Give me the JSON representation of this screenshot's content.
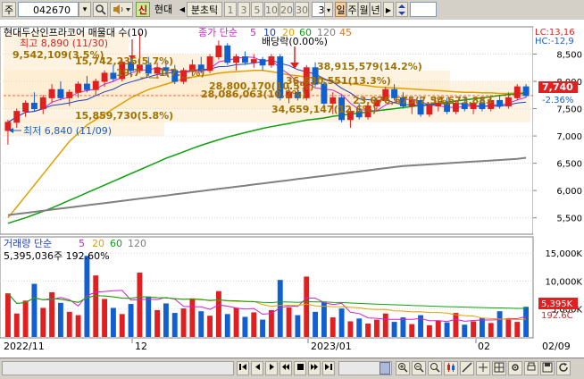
{
  "toolbar": {
    "menu_label": "주",
    "stock_code": "042670",
    "dropdown_glyph": "▾",
    "search_icon": "magnifier",
    "speaker_icon": "speaker",
    "credit_badge": "신",
    "stock_name": "현대",
    "prev_arrow": "◀",
    "period_label": "분초틱",
    "intervals": [
      "1",
      "3",
      "5",
      "10",
      "20",
      "30"
    ],
    "selected_count": "3",
    "period_tabs": [
      "일",
      "주",
      "월",
      "년"
    ],
    "selected_period": "일",
    "nav_arrow": "▶",
    "updown_icon": "updown-arrows"
  },
  "price_panel": {
    "legend_title": "현대두산인프라코어 매물대 수(10)",
    "legend_ma_label": "종가 단순",
    "legend_ma_periods": [
      "5",
      "10",
      "20",
      "60",
      "120",
      "45"
    ],
    "annotations": {
      "high": "최고 8,890 (11/30)",
      "low": "최저 6,840 (11/09)",
      "dividend": "배당락(0.00%)"
    },
    "volume_profile_labels": [
      "9,542,109(3.5%)",
      "15,742,236(5.7%)",
      "19,7_,__1(7.__%)",
      "28,086,063(10.2%)",
      "28,800,170(10.5%)",
      "38,915,579(14.2%)",
      "36,630,551(13.3%)",
      "34,659,147(12.6%)",
      "23,076,675(7.5%)",
      "34,673,883",
      "15,859,730(5.8%)"
    ],
    "right_labels": {
      "lc": "LC:13,16",
      "hc": "HC:-12,9",
      "current_price": "7,740",
      "change_pct": "-2.36%"
    }
  },
  "volume_panel": {
    "legend_title": "거래량 단순",
    "legend_ma_periods": [
      "5",
      "20",
      "60",
      "120"
    ],
    "summary": "5,395,036주 192.60%",
    "right_labels": {
      "current_volume": "5,395K",
      "volume_ratio": "192.6C"
    }
  },
  "x_axis": {
    "labels": [
      "2022/11",
      "12",
      "2023/01",
      "02",
      "02/09"
    ]
  },
  "colors": {
    "up": "#e02020",
    "down": "#1060d0",
    "ma5": "#d020d0",
    "ma10": "#2040c0",
    "ma20": "#e0a000",
    "ma60": "#10a010",
    "ma120": "#808080",
    "ma45": "#e07820",
    "profile": "#fde9c9"
  },
  "chart_data": [
    {
      "type": "candlestick",
      "title": "현대두산인프라코어 매물대 수(10)",
      "y_ticks": [
        5500,
        6000,
        6500,
        7000,
        7500,
        8000,
        8500
      ],
      "ylim": [
        5200,
        9000
      ],
      "x_start_date": "2022/11",
      "x_end_date": "2023/02/09",
      "ohlc": [
        [
          7100,
          7300,
          6840,
          7250
        ],
        [
          7250,
          7500,
          7150,
          7450
        ],
        [
          7450,
          7650,
          7350,
          7600
        ],
        [
          7600,
          7800,
          7450,
          7500
        ],
        [
          7500,
          7750,
          7400,
          7700
        ],
        [
          7700,
          7950,
          7600,
          7850
        ],
        [
          7850,
          8000,
          7650,
          7700
        ],
        [
          7700,
          7850,
          7550,
          7800
        ],
        [
          7800,
          8000,
          7700,
          7950
        ],
        [
          7950,
          8100,
          7800,
          7850
        ],
        [
          7850,
          8050,
          7750,
          8000
        ],
        [
          8000,
          8200,
          7900,
          8150
        ],
        [
          8150,
          8300,
          8000,
          8050
        ],
        [
          8050,
          8400,
          8000,
          8350
        ],
        [
          8350,
          8450,
          8100,
          8200
        ],
        [
          8200,
          8890,
          8150,
          8300
        ],
        [
          8300,
          8450,
          8100,
          8150
        ],
        [
          8150,
          8350,
          8050,
          8250
        ],
        [
          8250,
          8400,
          8100,
          8200
        ],
        [
          8200,
          8300,
          7950,
          8000
        ],
        [
          8000,
          8250,
          7950,
          8200
        ],
        [
          8200,
          8400,
          8100,
          8300
        ],
        [
          8300,
          8450,
          8150,
          8200
        ],
        [
          8200,
          8500,
          8150,
          8450
        ],
        [
          8450,
          8750,
          8400,
          8650
        ],
        [
          8650,
          8700,
          8300,
          8350
        ],
        [
          8350,
          8500,
          8200,
          8450
        ],
        [
          8450,
          8550,
          8300,
          8350
        ],
        [
          8350,
          8500,
          8250,
          8400
        ],
        [
          8400,
          8450,
          8200,
          8300
        ],
        [
          8300,
          8500,
          8250,
          8450
        ],
        [
          8450,
          8500,
          7650,
          7700
        ],
        [
          7700,
          7900,
          7600,
          7800
        ],
        [
          7800,
          7950,
          7650,
          7700
        ],
        [
          7700,
          8300,
          7650,
          8250
        ],
        [
          8250,
          8350,
          7900,
          7950
        ],
        [
          7950,
          8000,
          7500,
          7600
        ],
        [
          7600,
          7800,
          7400,
          7700
        ],
        [
          7700,
          7750,
          7250,
          7300
        ],
        [
          7300,
          7500,
          7150,
          7450
        ],
        [
          7450,
          7600,
          7300,
          7350
        ],
        [
          7350,
          7600,
          7300,
          7550
        ],
        [
          7550,
          7700,
          7450,
          7650
        ],
        [
          7650,
          7900,
          7600,
          7850
        ],
        [
          7850,
          7950,
          7650,
          7700
        ],
        [
          7700,
          7800,
          7500,
          7550
        ],
        [
          7550,
          7700,
          7400,
          7650
        ],
        [
          7650,
          7700,
          7350,
          7400
        ],
        [
          7400,
          7600,
          7350,
          7550
        ],
        [
          7550,
          7700,
          7450,
          7600
        ],
        [
          7600,
          7700,
          7400,
          7450
        ],
        [
          7450,
          7650,
          7400,
          7600
        ],
        [
          7600,
          7700,
          7450,
          7500
        ],
        [
          7500,
          7650,
          7400,
          7600
        ],
        [
          7600,
          7700,
          7450,
          7500
        ],
        [
          7500,
          7700,
          7450,
          7650
        ],
        [
          7650,
          7750,
          7500,
          7550
        ],
        [
          7550,
          7800,
          7500,
          7700
        ],
        [
          7700,
          7950,
          7650,
          7900
        ],
        [
          7900,
          7950,
          7700,
          7740
        ]
      ],
      "moving_averages": {
        "ma20": [
          5500,
          5700,
          5900,
          6100,
          6300,
          6500,
          6700,
          6900,
          7050,
          7200,
          7300,
          7400,
          7500,
          7600,
          7700,
          7780,
          7850,
          7900,
          7950,
          8000,
          8050,
          8080,
          8100,
          8120,
          8150,
          8170,
          8180,
          8190,
          8200,
          8200,
          8180,
          8150,
          8120,
          8100,
          8080,
          8060,
          8030,
          8000,
          7980,
          7960,
          7940,
          7920,
          7900,
          7890,
          7880,
          7870,
          7860,
          7850,
          7840,
          7830,
          7820,
          7810,
          7800,
          7800,
          7790,
          7790,
          7780,
          7780,
          7790,
          7800
        ],
        "ma60": [
          5400,
          5450,
          5500,
          5560,
          5620,
          5680,
          5750,
          5820,
          5890,
          5960,
          6030,
          6100,
          6170,
          6240,
          6310,
          6380,
          6450,
          6520,
          6590,
          6650,
          6710,
          6770,
          6830,
          6880,
          6930,
          6980,
          7020,
          7060,
          7100,
          7140,
          7170,
          7200,
          7230,
          7260,
          7290,
          7310,
          7330,
          7360,
          7380,
          7400,
          7420,
          7440,
          7460,
          7480,
          7500,
          7520,
          7540,
          7560,
          7580,
          7600,
          7620,
          7640,
          7660,
          7680,
          7700,
          7720,
          7740,
          7760,
          7770,
          7780
        ],
        "ma120": [
          5550,
          5570,
          5590,
          5610,
          5630,
          5650,
          5670,
          5690,
          5710,
          5730,
          5750,
          5770,
          5790,
          5810,
          5830,
          5850,
          5870,
          5890,
          5910,
          5930,
          5950,
          5970,
          5990,
          6010,
          6030,
          6050,
          6070,
          6090,
          6110,
          6130,
          6150,
          6170,
          6190,
          6210,
          6230,
          6250,
          6270,
          6290,
          6310,
          6330,
          6350,
          6370,
          6390,
          6410,
          6430,
          6450,
          6460,
          6470,
          6480,
          6490,
          6500,
          6510,
          6520,
          6530,
          6540,
          6550,
          6560,
          6570,
          6580,
          6600
        ]
      }
    },
    {
      "type": "bar",
      "title": "거래량",
      "y_ticks": [
        5000,
        10000,
        15000
      ],
      "ylim": [
        0,
        15500
      ],
      "values": [
        7800,
        4200,
        6500,
        9500,
        5200,
        8000,
        6100,
        4500,
        3900,
        14500,
        11000,
        6800,
        5200,
        4100,
        5900,
        11500,
        7200,
        4800,
        6000,
        4300,
        5100,
        6900,
        4600,
        3800,
        8200,
        4100,
        5200,
        3600,
        4400,
        3100,
        4800,
        10200,
        5300,
        3900,
        10800,
        4500,
        6200,
        3500,
        5100,
        2800,
        3300,
        2400,
        3100,
        4200,
        2700,
        3500,
        2300,
        3900,
        2100,
        2900,
        2600,
        4300,
        2200,
        2800,
        3400,
        2500,
        4600,
        3200,
        2700,
        5395
      ],
      "up": [
        true,
        true,
        true,
        false,
        true,
        true,
        false,
        true,
        true,
        false,
        true,
        true,
        false,
        true,
        false,
        true,
        false,
        true,
        false,
        false,
        true,
        true,
        false,
        true,
        true,
        false,
        true,
        false,
        true,
        false,
        true,
        false,
        true,
        false,
        true,
        false,
        false,
        true,
        false,
        true,
        false,
        true,
        true,
        true,
        false,
        false,
        true,
        false,
        true,
        true,
        false,
        true,
        false,
        true,
        false,
        true,
        false,
        true,
        true,
        false
      ]
    }
  ]
}
